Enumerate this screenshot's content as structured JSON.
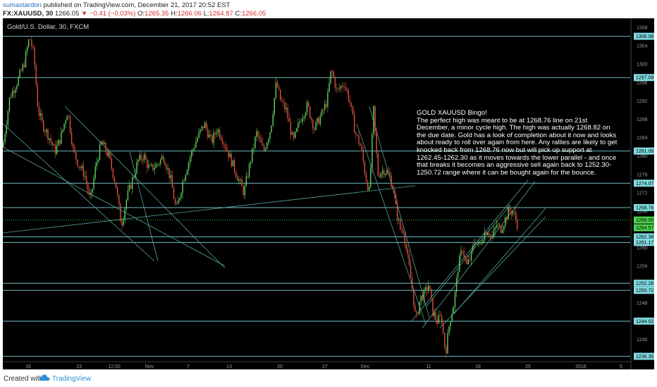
{
  "header": {
    "author": "sumastardon",
    "published": "published on TradingView.com, December 21, 2017 20:52 EST",
    "symbol": "FX:XAUUSD, 30",
    "last": "1266.05",
    "change": "▼ −0.41 (−0.03%)",
    "o_label": "O:",
    "o_value": "1265.35",
    "h_label": "H:",
    "h_value": "1266.06",
    "l_label": "L:",
    "l_value": "1264.87",
    "c_label": "C:",
    "c_value": "1266.05"
  },
  "chart_title": "Gold/U.S. Dollar, 30, FXCM",
  "annotation": {
    "title": "GOLD XAUUSD  Bingo!",
    "body": "The perfect high was meant to be at 1268.76 line on 21st December, a minor cycle high. The high was actually 1268.82 on the due date. Gold has a look of completion about it now and looks about ready to roll over again from here. Any rallies are likely to get knocked back from 1268.76 now but will pick up support at 1262.45-1262.30 as it moves towards the lower parallel - and once that breaks it becomes an aggressive sell again back to 1252.30-1250.72 range where it can be bought again for the bounce."
  },
  "footer": {
    "created": "Created with",
    "brand": "TradingView"
  },
  "colors": {
    "background": "#000000",
    "level_line": "#7fdbe0",
    "trend_line": "#5fb8a8",
    "bull_candle": "#5fd35f",
    "bear_candle": "#e05040",
    "price_tag_green": "#4ed04e",
    "current_line": "#4ed04e"
  },
  "chart_data": {
    "type": "candlestick",
    "y_range": [
      1233.5,
      1310
    ],
    "y_ticks": [
      1240,
      1244,
      1248,
      1252,
      1256,
      1260,
      1264,
      1268,
      1272,
      1276,
      1280,
      1284,
      1288,
      1292,
      1296,
      1300,
      1304,
      1308
    ],
    "x_tick_labels": [
      "16",
      "23",
      "12:00",
      "Nov",
      "7",
      "13",
      "20",
      "27",
      "Dec",
      "11",
      "18",
      "25",
      "2018",
      "5"
    ],
    "horizontal_levels": [
      "1306.08",
      "1297.09",
      "1281.08",
      "1274.07",
      "1268.76",
      "1262.38",
      "1261.17",
      "1252.28",
      "1250.72",
      "1244.02",
      "1236.35"
    ],
    "current_price": "1266.05",
    "current_price_partial": "1264.57",
    "price_path": [
      [
        0,
        1282
      ],
      [
        10,
        1293
      ],
      [
        20,
        1296
      ],
      [
        30,
        1300
      ],
      [
        38,
        1306
      ],
      [
        44,
        1302
      ],
      [
        50,
        1290
      ],
      [
        56,
        1287
      ],
      [
        66,
        1284
      ],
      [
        74,
        1281
      ],
      [
        82,
        1284
      ],
      [
        92,
        1290
      ],
      [
        100,
        1281
      ],
      [
        108,
        1278
      ],
      [
        116,
        1276
      ],
      [
        124,
        1270
      ],
      [
        132,
        1278
      ],
      [
        140,
        1283
      ],
      [
        150,
        1280
      ],
      [
        160,
        1274
      ],
      [
        168,
        1265
      ],
      [
        176,
        1271
      ],
      [
        184,
        1275
      ],
      [
        192,
        1279
      ],
      [
        200,
        1280
      ],
      [
        208,
        1277
      ],
      [
        218,
        1278
      ],
      [
        228,
        1280
      ],
      [
        238,
        1275
      ],
      [
        246,
        1268
      ],
      [
        256,
        1275
      ],
      [
        266,
        1280
      ],
      [
        276,
        1284
      ],
      [
        286,
        1287
      ],
      [
        296,
        1283
      ],
      [
        304,
        1286
      ],
      [
        314,
        1283
      ],
      [
        324,
        1279
      ],
      [
        334,
        1275
      ],
      [
        342,
        1272
      ],
      [
        350,
        1278
      ],
      [
        360,
        1285
      ],
      [
        370,
        1281
      ],
      [
        380,
        1286
      ],
      [
        388,
        1296
      ],
      [
        394,
        1292
      ],
      [
        402,
        1290
      ],
      [
        412,
        1283
      ],
      [
        422,
        1288
      ],
      [
        432,
        1291
      ],
      [
        442,
        1286
      ],
      [
        452,
        1289
      ],
      [
        460,
        1292
      ],
      [
        466,
        1299
      ],
      [
        474,
        1294
      ],
      [
        484,
        1296
      ],
      [
        492,
        1292
      ],
      [
        500,
        1285
      ],
      [
        508,
        1282
      ],
      [
        514,
        1276
      ],
      [
        520,
        1272
      ],
      [
        526,
        1290
      ],
      [
        532,
        1276
      ],
      [
        540,
        1277
      ],
      [
        548,
        1276
      ],
      [
        554,
        1273
      ],
      [
        558,
        1268
      ],
      [
        564,
        1264
      ],
      [
        568,
        1264
      ],
      [
        574,
        1258
      ],
      [
        580,
        1252
      ],
      [
        586,
        1244
      ],
      [
        592,
        1249
      ],
      [
        598,
        1250
      ],
      [
        604,
        1252
      ],
      [
        610,
        1246
      ],
      [
        616,
        1244
      ],
      [
        622,
        1245
      ],
      [
        628,
        1237
      ],
      [
        634,
        1244
      ],
      [
        640,
        1248
      ],
      [
        646,
        1256
      ],
      [
        652,
        1260
      ],
      [
        658,
        1256
      ],
      [
        664,
        1258
      ],
      [
        670,
        1262
      ],
      [
        676,
        1260
      ],
      [
        682,
        1263
      ],
      [
        688,
        1264
      ],
      [
        694,
        1262
      ],
      [
        700,
        1265
      ],
      [
        706,
        1264
      ],
      [
        712,
        1266
      ],
      [
        718,
        1268
      ],
      [
        724,
        1268
      ],
      [
        730,
        1265
      ]
    ],
    "grid": false
  }
}
